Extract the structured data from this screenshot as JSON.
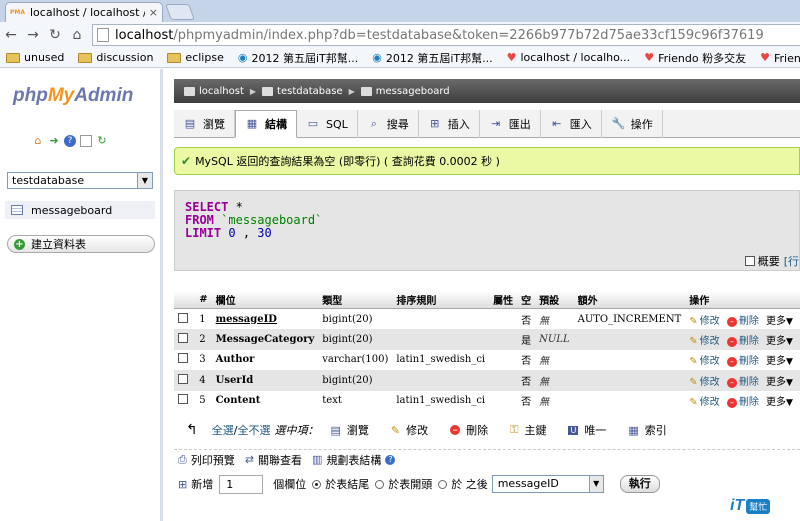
{
  "browser": {
    "tab_title": "localhost / localhost / tes",
    "tab_close": "×",
    "url_host": "localhost",
    "url_rest": "/phpmyadmin/index.php?db=testdatabase&token=2266b977b72d75ae33cf159c96f37619"
  },
  "bookmarks": [
    {
      "label": "unused",
      "kind": "folder"
    },
    {
      "label": "discussion",
      "kind": "folder"
    },
    {
      "label": "eclipse",
      "kind": "folder"
    },
    {
      "label": "2012 第五屆iT邦幫...",
      "kind": "page"
    },
    {
      "label": "2012 第五屆iT邦幫...",
      "kind": "page"
    },
    {
      "label": "localhost / localho...",
      "kind": "heart"
    },
    {
      "label": "Friendo 粉多交友",
      "kind": "heart"
    },
    {
      "label": "Friendo 粉多交友",
      "kind": "heart"
    }
  ],
  "sidebar": {
    "logo": {
      "php": "php",
      "my": "My",
      "admin": "Admin"
    },
    "icons": [
      "home-icon",
      "logout-icon",
      "help-icon",
      "docs-icon",
      "reload-icon"
    ],
    "db_selected": "testdatabase",
    "table_item": "messageboard",
    "create_table": "建立資料表"
  },
  "breadcrumb": {
    "server": "localhost",
    "database": "testdatabase",
    "table": "messageboard"
  },
  "tabs": [
    {
      "label": "瀏覽",
      "icon": "browse-icon",
      "active": false
    },
    {
      "label": "結構",
      "icon": "structure-icon",
      "active": true
    },
    {
      "label": "SQL",
      "icon": "sql-icon",
      "active": false
    },
    {
      "label": "搜尋",
      "icon": "search-icon",
      "active": false
    },
    {
      "label": "插入",
      "icon": "insert-icon",
      "active": false
    },
    {
      "label": "匯出",
      "icon": "export-icon",
      "active": false
    },
    {
      "label": "匯入",
      "icon": "import-icon",
      "active": false
    },
    {
      "label": "操作",
      "icon": "operations-icon",
      "active": false
    }
  ],
  "message": "MySQL 返回的查詢結果為空 (即零行) ( 查詢花費 0.0002 秒 )",
  "sql": {
    "select": "SELECT",
    "star": "*",
    "from": "FROM",
    "table": "`messageboard`",
    "limit": "LIMIT",
    "offset": "0",
    "comma": ",",
    "count": "30"
  },
  "profile": {
    "label": "概要",
    "link": "[行"
  },
  "structure": {
    "headers": [
      "#",
      "欄位",
      "類型",
      "排序規則",
      "屬性",
      "空",
      "預設",
      "額外",
      "操作"
    ],
    "edit": "修改",
    "drop": "刪除",
    "more": "更多",
    "rows": [
      {
        "num": "1",
        "name": "messageID",
        "type": "bigint(20)",
        "collation": "",
        "null": "否",
        "default": "無",
        "extra": "AUTO_INCREMENT",
        "primary": true
      },
      {
        "num": "2",
        "name": "MessageCategory",
        "type": "bigint(20)",
        "collation": "",
        "null": "是",
        "default": "NULL",
        "extra": "",
        "primary": false
      },
      {
        "num": "3",
        "name": "Author",
        "type": "varchar(100)",
        "collation": "latin1_swedish_ci",
        "null": "否",
        "default": "無",
        "extra": "",
        "primary": false
      },
      {
        "num": "4",
        "name": "UserId",
        "type": "bigint(20)",
        "collation": "",
        "null": "否",
        "default": "無",
        "extra": "",
        "primary": false
      },
      {
        "num": "5",
        "name": "Content",
        "type": "text",
        "collation": "latin1_swedish_ci",
        "null": "否",
        "default": "無",
        "extra": "",
        "primary": false
      }
    ]
  },
  "with_selected": {
    "check_all": "全選",
    "slash": " / ",
    "uncheck_all": "全不選",
    "label": "選中項：",
    "actions": [
      {
        "label": "瀏覽",
        "icon": "browse-icon"
      },
      {
        "label": "修改",
        "icon": "pencil-icon"
      },
      {
        "label": "刪除",
        "icon": "drop-icon"
      },
      {
        "label": "主鍵",
        "icon": "key-icon"
      },
      {
        "label": "唯一",
        "icon": "unique-icon"
      },
      {
        "label": "索引",
        "icon": "index-icon"
      }
    ]
  },
  "bottom_links": [
    {
      "label": "列印預覽",
      "icon": "print-icon"
    },
    {
      "label": "關聯查看",
      "icon": "relation-icon"
    },
    {
      "label": "規劃表結構",
      "icon": "propose-icon"
    }
  ],
  "add_column": {
    "label": "新增",
    "count": "1",
    "unit": "個欄位",
    "opt_end": "於表結尾",
    "opt_begin": "於表開頭",
    "opt_after": "於 之後",
    "after_col": "messageID",
    "go": "執行"
  },
  "watermark": {
    "it": "iT",
    "bang": "幫忙"
  },
  "colors": {
    "accent": "#235a81",
    "success_bg": "#ebf8a4",
    "keyword": "#990099"
  }
}
